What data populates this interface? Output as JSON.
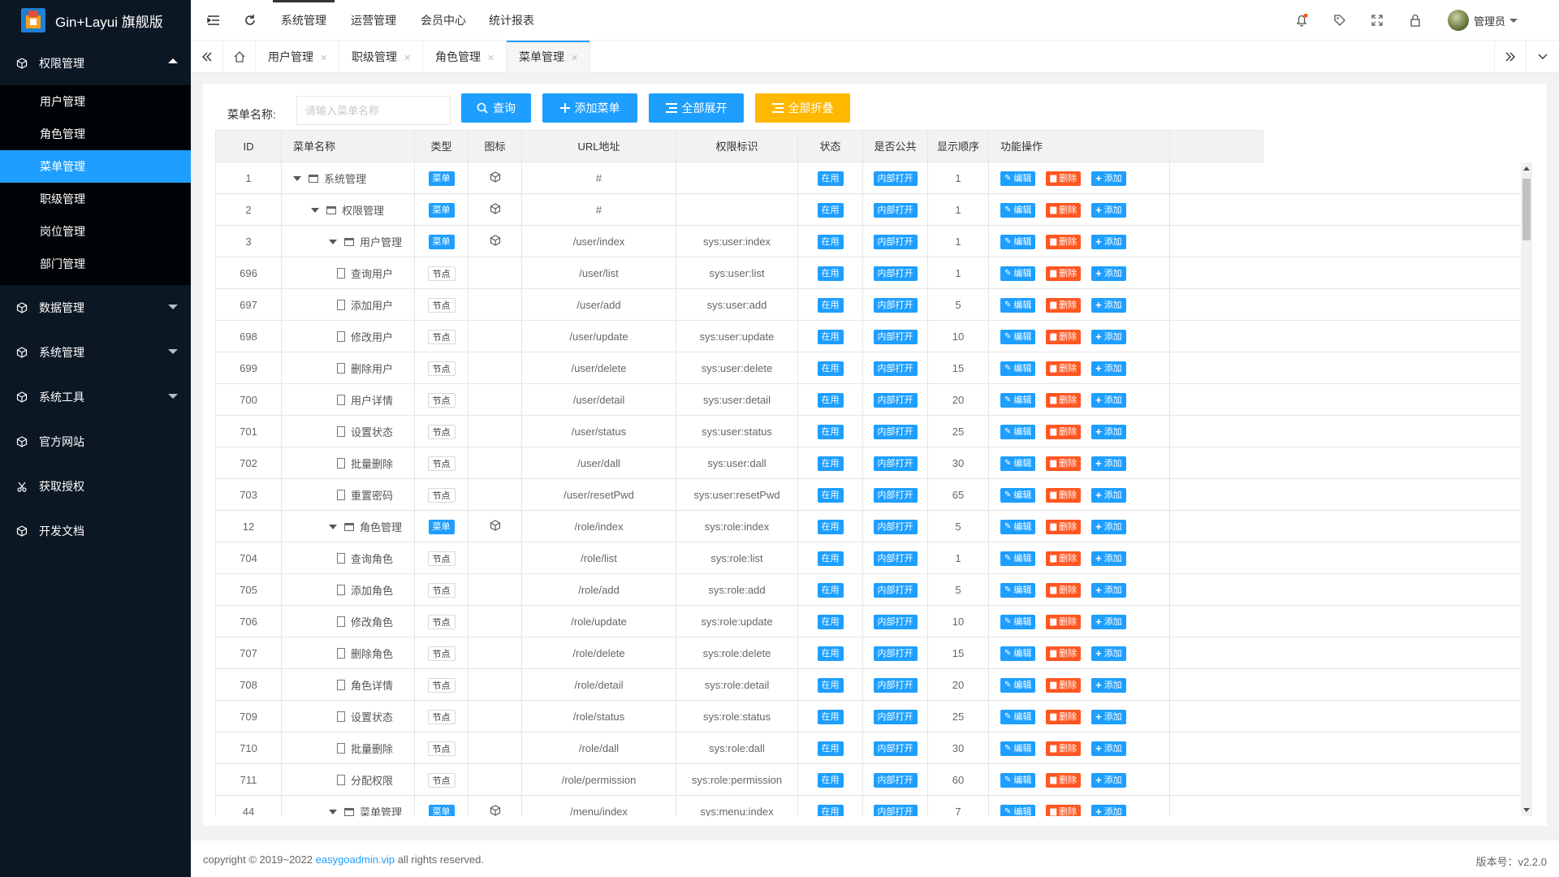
{
  "app": {
    "title": "Gin+Layui 旗舰版"
  },
  "colors": {
    "accent": "#1e9fff",
    "sidebar": "#0c1724",
    "danger": "#ff5722",
    "warning": "#ffb800"
  },
  "sidebar": {
    "groups": [
      {
        "label": "权限管理",
        "icon": "cube-icon",
        "open": true,
        "items": [
          "用户管理",
          "角色管理",
          "菜单管理",
          "职级管理",
          "岗位管理",
          "部门管理"
        ],
        "active": "菜单管理"
      },
      {
        "label": "数据管理",
        "icon": "cube-icon"
      },
      {
        "label": "系统管理",
        "icon": "cube-icon"
      },
      {
        "label": "系统工具",
        "icon": "cube-icon"
      },
      {
        "label": "官方网站",
        "icon": "cube-icon"
      },
      {
        "label": "获取授权",
        "icon": "scissors-icon"
      },
      {
        "label": "开发文档",
        "icon": "cube-icon"
      }
    ]
  },
  "header": {
    "nav": [
      "系统管理",
      "运营管理",
      "会员中心",
      "统计报表"
    ],
    "active_nav": "系统管理",
    "user": "管理员"
  },
  "tabs": {
    "items": [
      "用户管理",
      "职级管理",
      "角色管理",
      "菜单管理"
    ],
    "active": "菜单管理"
  },
  "search": {
    "label": "菜单名称:",
    "placeholder": "请输入菜单名称",
    "query_btn": "查询",
    "add_btn": "添加菜单",
    "expand_btn": "全部展开",
    "collapse_btn": "全部折叠"
  },
  "table": {
    "columns": [
      "ID",
      "菜单名称",
      "类型",
      "图标",
      "URL地址",
      "权限标识",
      "状态",
      "是否公共",
      "显示顺序",
      "功能操作"
    ],
    "rows": [
      {
        "id": "1",
        "name": "系统管理",
        "level": 0,
        "kind": "folder",
        "type": "菜单",
        "icon": true,
        "url": "#",
        "perm": "",
        "status": "在用",
        "public": "内部打开",
        "order": "1"
      },
      {
        "id": "2",
        "name": "权限管理",
        "level": 1,
        "kind": "folder",
        "type": "菜单",
        "icon": true,
        "url": "#",
        "perm": "",
        "status": "在用",
        "public": "内部打开",
        "order": "1"
      },
      {
        "id": "3",
        "name": "用户管理",
        "level": 2,
        "kind": "folder",
        "type": "菜单",
        "icon": true,
        "url": "/user/index",
        "perm": "sys:user:index",
        "status": "在用",
        "public": "内部打开",
        "order": "1"
      },
      {
        "id": "696",
        "name": "查询用户",
        "level": 3,
        "kind": "doc",
        "type": "节点",
        "icon": false,
        "url": "/user/list",
        "perm": "sys:user:list",
        "status": "在用",
        "public": "内部打开",
        "order": "1"
      },
      {
        "id": "697",
        "name": "添加用户",
        "level": 3,
        "kind": "doc",
        "type": "节点",
        "icon": false,
        "url": "/user/add",
        "perm": "sys:user:add",
        "status": "在用",
        "public": "内部打开",
        "order": "5"
      },
      {
        "id": "698",
        "name": "修改用户",
        "level": 3,
        "kind": "doc",
        "type": "节点",
        "icon": false,
        "url": "/user/update",
        "perm": "sys:user:update",
        "status": "在用",
        "public": "内部打开",
        "order": "10"
      },
      {
        "id": "699",
        "name": "删除用户",
        "level": 3,
        "kind": "doc",
        "type": "节点",
        "icon": false,
        "url": "/user/delete",
        "perm": "sys:user:delete",
        "status": "在用",
        "public": "内部打开",
        "order": "15"
      },
      {
        "id": "700",
        "name": "用户详情",
        "level": 3,
        "kind": "doc",
        "type": "节点",
        "icon": false,
        "url": "/user/detail",
        "perm": "sys:user:detail",
        "status": "在用",
        "public": "内部打开",
        "order": "20"
      },
      {
        "id": "701",
        "name": "设置状态",
        "level": 3,
        "kind": "doc",
        "type": "节点",
        "icon": false,
        "url": "/user/status",
        "perm": "sys:user:status",
        "status": "在用",
        "public": "内部打开",
        "order": "25"
      },
      {
        "id": "702",
        "name": "批量删除",
        "level": 3,
        "kind": "doc",
        "type": "节点",
        "icon": false,
        "url": "/user/dall",
        "perm": "sys:user:dall",
        "status": "在用",
        "public": "内部打开",
        "order": "30"
      },
      {
        "id": "703",
        "name": "重置密码",
        "level": 3,
        "kind": "doc",
        "type": "节点",
        "icon": false,
        "url": "/user/resetPwd",
        "perm": "sys:user:resetPwd",
        "status": "在用",
        "public": "内部打开",
        "order": "65"
      },
      {
        "id": "12",
        "name": "角色管理",
        "level": 2,
        "kind": "folder",
        "type": "菜单",
        "icon": true,
        "url": "/role/index",
        "perm": "sys:role:index",
        "status": "在用",
        "public": "内部打开",
        "order": "5"
      },
      {
        "id": "704",
        "name": "查询角色",
        "level": 3,
        "kind": "doc",
        "type": "节点",
        "icon": false,
        "url": "/role/list",
        "perm": "sys:role:list",
        "status": "在用",
        "public": "内部打开",
        "order": "1"
      },
      {
        "id": "705",
        "name": "添加角色",
        "level": 3,
        "kind": "doc",
        "type": "节点",
        "icon": false,
        "url": "/role/add",
        "perm": "sys:role:add",
        "status": "在用",
        "public": "内部打开",
        "order": "5"
      },
      {
        "id": "706",
        "name": "修改角色",
        "level": 3,
        "kind": "doc",
        "type": "节点",
        "icon": false,
        "url": "/role/update",
        "perm": "sys:role:update",
        "status": "在用",
        "public": "内部打开",
        "order": "10"
      },
      {
        "id": "707",
        "name": "删除角色",
        "level": 3,
        "kind": "doc",
        "type": "节点",
        "icon": false,
        "url": "/role/delete",
        "perm": "sys:role:delete",
        "status": "在用",
        "public": "内部打开",
        "order": "15"
      },
      {
        "id": "708",
        "name": "角色详情",
        "level": 3,
        "kind": "doc",
        "type": "节点",
        "icon": false,
        "url": "/role/detail",
        "perm": "sys:role:detail",
        "status": "在用",
        "public": "内部打开",
        "order": "20"
      },
      {
        "id": "709",
        "name": "设置状态",
        "level": 3,
        "kind": "doc",
        "type": "节点",
        "icon": false,
        "url": "/role/status",
        "perm": "sys:role:status",
        "status": "在用",
        "public": "内部打开",
        "order": "25"
      },
      {
        "id": "710",
        "name": "批量删除",
        "level": 3,
        "kind": "doc",
        "type": "节点",
        "icon": false,
        "url": "/role/dall",
        "perm": "sys:role:dall",
        "status": "在用",
        "public": "内部打开",
        "order": "30"
      },
      {
        "id": "711",
        "name": "分配权限",
        "level": 3,
        "kind": "doc",
        "type": "节点",
        "icon": false,
        "url": "/role/permission",
        "perm": "sys:role:permission",
        "status": "在用",
        "public": "内部打开",
        "order": "60"
      },
      {
        "id": "44",
        "name": "菜单管理",
        "level": 2,
        "kind": "folder",
        "type": "菜单",
        "icon": true,
        "url": "/menu/index",
        "perm": "sys:menu:index",
        "status": "在用",
        "public": "内部打开",
        "order": "7"
      }
    ],
    "actions": {
      "edit": "编辑",
      "delete": "删除",
      "add": "添加"
    }
  },
  "footer": {
    "copy_prefix": "copyright © 2019~2022 ",
    "copy_link": "easygoadmin.vip",
    "copy_suffix": " all rights reserved.",
    "version": "版本号：v2.2.0"
  }
}
